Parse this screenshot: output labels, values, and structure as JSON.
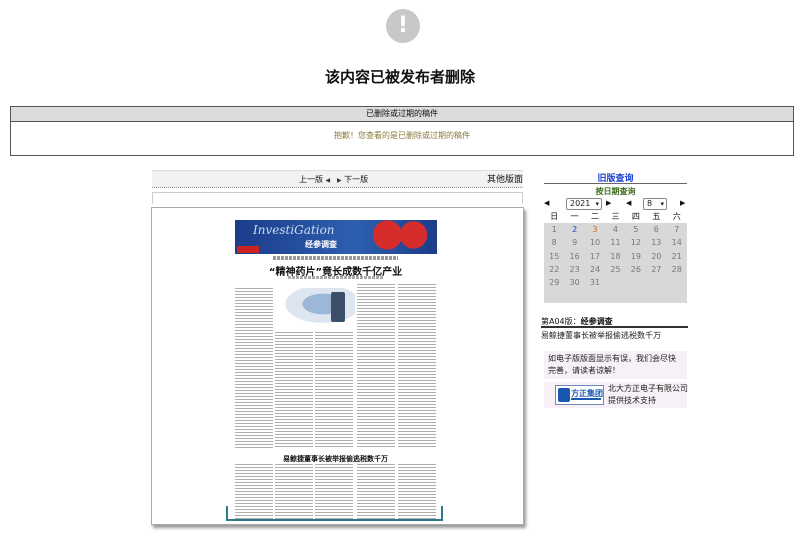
{
  "alert": {
    "icon": "!",
    "title": "该内容已被发布者删除"
  },
  "notice": {
    "header": "已删除或过期的稿件",
    "message": "抱歉！您查看的是已删除或过期的稿件"
  },
  "pager": {
    "prev": "上一版",
    "next": "下一版",
    "other": "其他版面"
  },
  "newspaper": {
    "banner_en": "InvestiGation",
    "banner_cn": "经参调查",
    "headline": "“精神药片”竟长成数千亿产业",
    "headline2": "易鲸捷董事长被举报偷逃税数千万"
  },
  "history": {
    "title": "旧版查询",
    "subtitle": "按日期查询",
    "year": "2021",
    "month": "8",
    "weekdays": [
      "日",
      "一",
      "二",
      "三",
      "四",
      "五",
      "六"
    ],
    "weeks": [
      [
        "1",
        "2",
        "3",
        "4",
        "5",
        "6",
        "7"
      ],
      [
        "8",
        "9",
        "10",
        "11",
        "12",
        "13",
        "14"
      ],
      [
        "15",
        "16",
        "17",
        "18",
        "19",
        "20",
        "21"
      ],
      [
        "22",
        "23",
        "24",
        "25",
        "26",
        "27",
        "28"
      ],
      [
        "29",
        "30",
        "31",
        "",
        "",
        "",
        ""
      ]
    ]
  },
  "edition": {
    "prefix": "第A04版：",
    "name": "经参调查",
    "article": "易鲸捷董事长被举报偷逃税数千万"
  },
  "feedback": {
    "line1": "如电子版版面显示有误，我们会尽快",
    "line2": "完善，请读者谅解！"
  },
  "founder": {
    "logo": "方正集团",
    "line1": "北大方正电子有限公司",
    "line2": "提供技术支持"
  },
  "colors": {
    "link_blue": "#1a3fd0",
    "date_orange": "#d86a10",
    "calendar_bg": "#d8d8d8"
  }
}
